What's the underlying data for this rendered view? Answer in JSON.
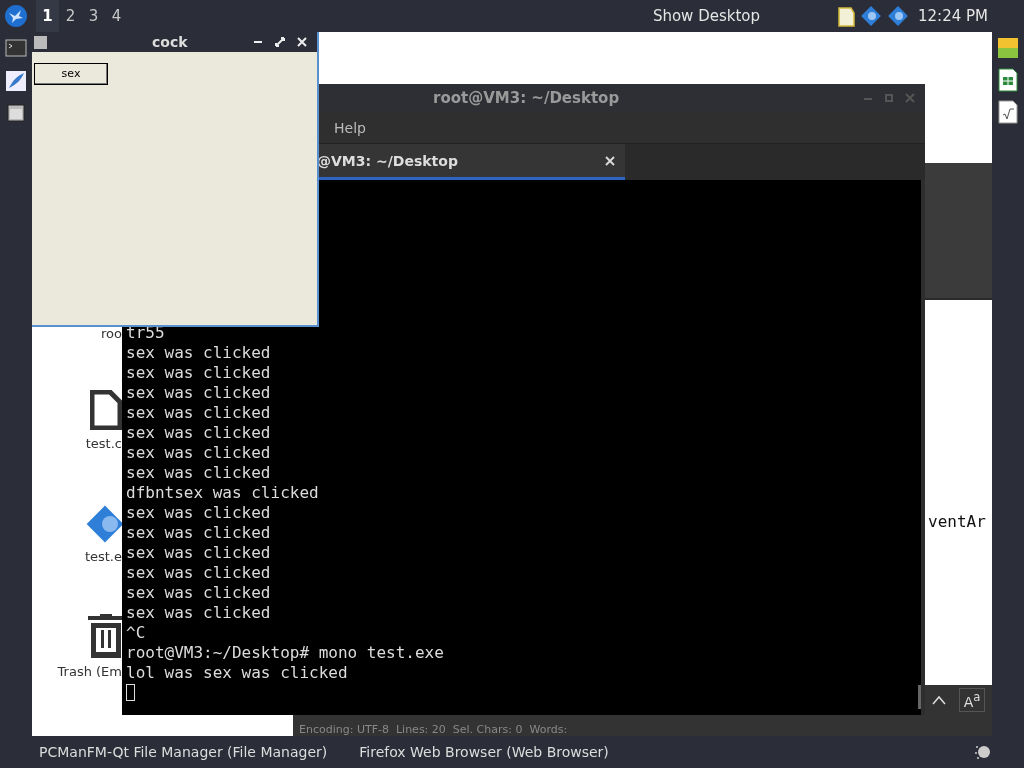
{
  "top_panel": {
    "workspaces": [
      {
        "label": "1",
        "selected": true
      },
      {
        "label": "2",
        "selected": false
      },
      {
        "label": "3",
        "selected": false
      },
      {
        "label": "4",
        "selected": false
      }
    ],
    "show_desktop": "Show Desktop",
    "clock": "12:24 PM"
  },
  "desktop_icons": [
    {
      "label": "roo"
    },
    {
      "label": "test.c",
      "kind": "file"
    },
    {
      "label": "test.e",
      "kind": "app"
    },
    {
      "label": "Trash (Em",
      "kind": "trash"
    }
  ],
  "editor_window": {
    "visible_text": "ventAr",
    "status_bar": "Encoding: UTF-8  Lines: 20  Sel. Chars: 0  Words:",
    "font_button": "A$^{a}$"
  },
  "terminal_window": {
    "title": "root@VM3: ~/Desktop",
    "menu": [
      "Help"
    ],
    "tabs": [
      {
        "label": "@VM3: ~/Desktop",
        "selected": true
      }
    ],
    "lines": [
      "tr55",
      "sex was clicked",
      "sex was clicked",
      "sex was clicked",
      "sex was clicked",
      "sex was clicked",
      "sex was clicked",
      "sex was clicked",
      "dfbntsex was clicked",
      "sex was clicked",
      "sex was clicked",
      "sex was clicked",
      "sex was clicked",
      "sex was clicked",
      "sex was clicked",
      "^C",
      "root@VM3:~/Desktop# mono test.exe",
      "lol was sex was clicked"
    ]
  },
  "app_window": {
    "title": "cock",
    "button": "sex"
  },
  "taskbar": {
    "items": [
      {
        "label": "PCManFM-Qt File Manager (File Manager)"
      },
      {
        "label": "Firefox Web Browser (Web Browser)"
      }
    ]
  }
}
